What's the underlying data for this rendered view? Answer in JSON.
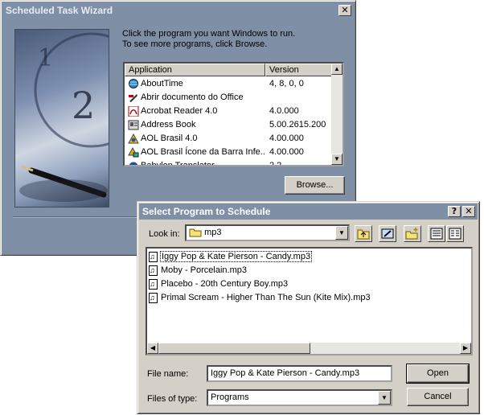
{
  "wizard": {
    "title": "Scheduled Task Wizard",
    "close_glyph": "✕",
    "instruction_line1": "Click the program you want Windows to run.",
    "instruction_line2": "To see more programs, click Browse.",
    "columns": [
      "Application",
      "Version"
    ],
    "applications": [
      {
        "name": "AboutTime",
        "version": "4, 8, 0, 0",
        "icon": "globe-clock-icon"
      },
      {
        "name": "Abrir documento do Office",
        "version": "",
        "icon": "office-icon"
      },
      {
        "name": "Acrobat Reader 4.0",
        "version": "4.0.000",
        "icon": "acrobat-icon"
      },
      {
        "name": "Address Book",
        "version": "5.00.2615.200",
        "icon": "address-book-icon"
      },
      {
        "name": "AOL Brasil 4.0",
        "version": "4.00.000",
        "icon": "aol-icon"
      },
      {
        "name": "AOL Brasil Ícone da Barra Infe...",
        "version": "4.00.000",
        "icon": "aol-tray-icon"
      },
      {
        "name": "Babylon Translator",
        "version": "2.2",
        "icon": "babylon-icon"
      }
    ],
    "browse_label": "Browse..."
  },
  "dialog": {
    "title": "Select Program to Schedule",
    "help_glyph": "?",
    "close_glyph": "✕",
    "look_in_label": "Look in:",
    "look_in_value": "mp3",
    "files": [
      "Iggy Pop & Kate Pierson - Candy.mp3",
      "Moby - Porcelain.mp3",
      "Placebo - 20th Century Boy.mp3",
      "Primal Scream - Higher Than The Sun (Kite Mix).mp3"
    ],
    "file_name_label": "File name:",
    "file_name_value": "Iggy Pop & Kate Pierson - Candy.mp3",
    "file_type_label": "Files of type:",
    "file_type_value": "Programs",
    "open_label": "Open",
    "cancel_label": "Cancel"
  }
}
